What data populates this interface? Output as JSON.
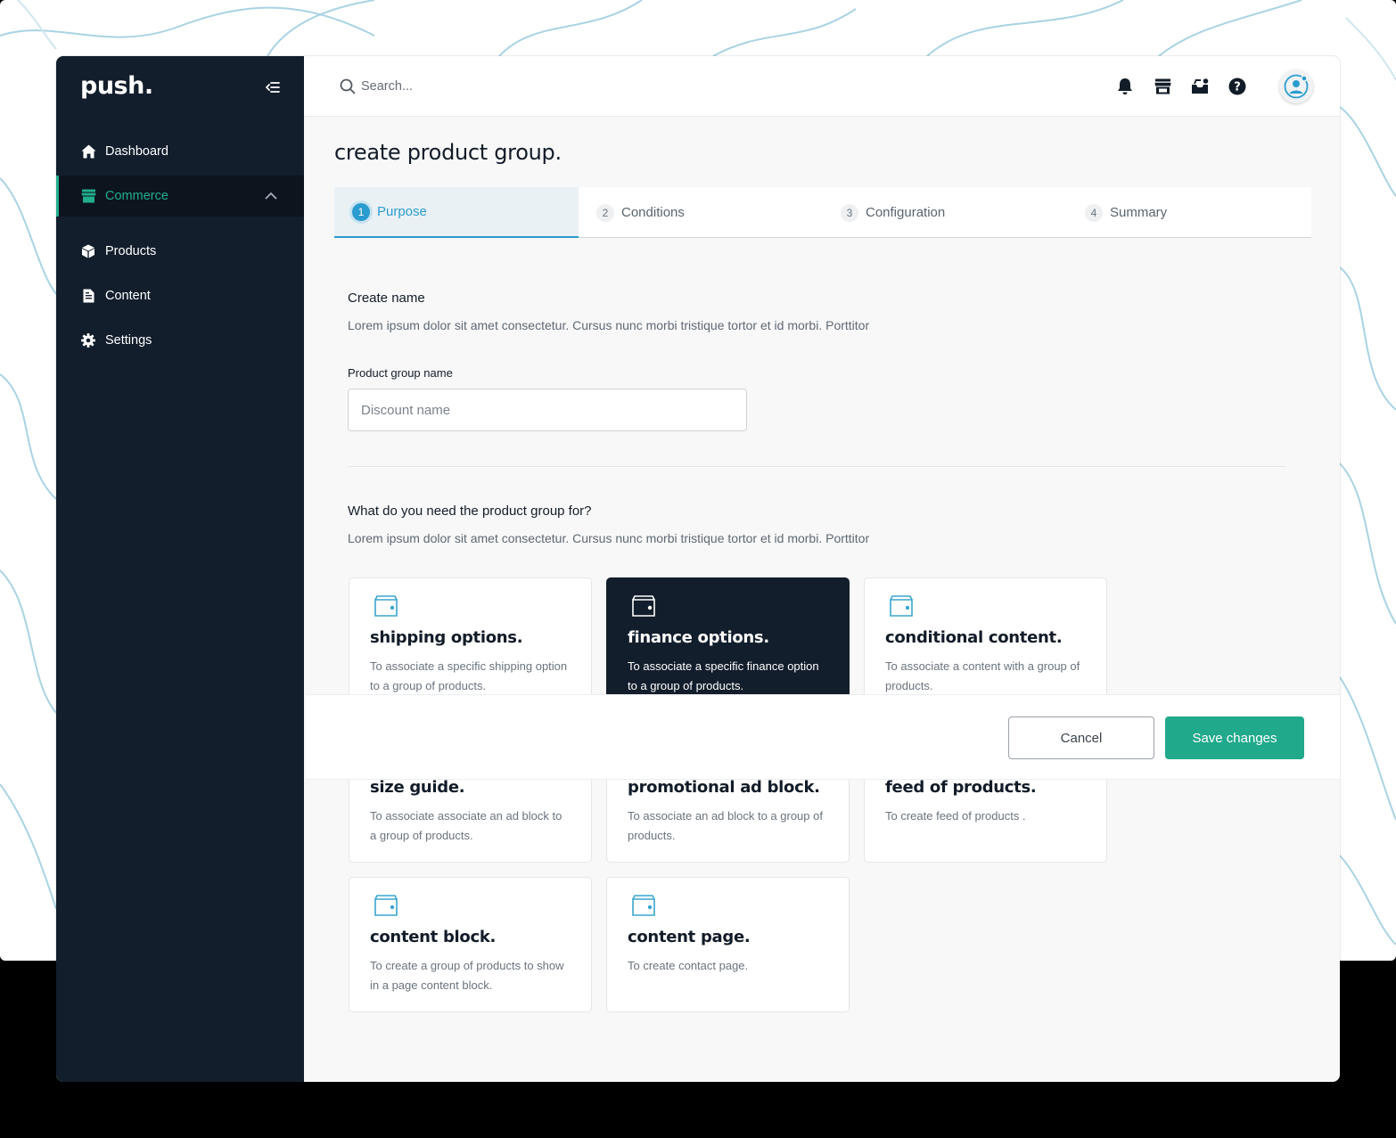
{
  "app": {
    "logo": "push.",
    "colors": {
      "sidebar": "#131e2c",
      "accent": "#22ad8c",
      "step_active": "#2b9ccf",
      "icon_blue": "#3aa5cf"
    }
  },
  "sidebar": {
    "collapse_icon": "collapse-menu-icon",
    "items": [
      {
        "label": "Dashboard",
        "icon": "home-icon"
      },
      {
        "label": "Commerce",
        "icon": "store-icon",
        "active": true,
        "expanded": true
      },
      {
        "label": "Products",
        "icon": "box-icon"
      },
      {
        "label": "Content",
        "icon": "document-icon"
      },
      {
        "label": "Settings",
        "icon": "gear-icon"
      }
    ]
  },
  "header": {
    "search_placeholder": "Search...",
    "icons": [
      "bell-icon",
      "store-icon",
      "inbox-icon",
      "help-icon",
      "avatar-icon"
    ]
  },
  "page": {
    "title": "create product group.",
    "steps": [
      {
        "num": "1",
        "label": "Purpose",
        "active": true
      },
      {
        "num": "2",
        "label": "Conditions"
      },
      {
        "num": "3",
        "label": "Configuration"
      },
      {
        "num": "4",
        "label": "Summary"
      }
    ],
    "name_section": {
      "title": "Create name",
      "description": "Lorem ipsum dolor sit amet consectetur. Cursus nunc morbi tristique tortor et id morbi. Porttitor",
      "field_label": "Product group name",
      "field_placeholder": "Discount name"
    },
    "purpose_section": {
      "title": "What do you need the product group for?",
      "description": "Lorem ipsum dolor sit amet consectetur. Cursus nunc morbi tristique tortor et id morbi. Porttitor"
    },
    "cards": [
      {
        "title": "shipping options.",
        "desc": "To associate a specific shipping option to a group of products."
      },
      {
        "title": "finance options.",
        "desc": "To associate a specific finance option to a group of products.",
        "selected": true
      },
      {
        "title": "conditional content.",
        "desc": "To associate a content with a group of products."
      },
      {
        "title": "size guide.",
        "desc": "To associate associate an ad block to a group of products."
      },
      {
        "title": "promotional ad block.",
        "desc": "To associate an ad block to a group of products."
      },
      {
        "title": "feed of products.",
        "desc": "To create feed of  products ."
      },
      {
        "title": "content block.",
        "desc": "To create  a group of products to show in a page content block."
      },
      {
        "title": "content page.",
        "desc": "To create contact page."
      }
    ]
  },
  "footer": {
    "cancel_label": "Cancel",
    "save_label": "Save changes"
  }
}
